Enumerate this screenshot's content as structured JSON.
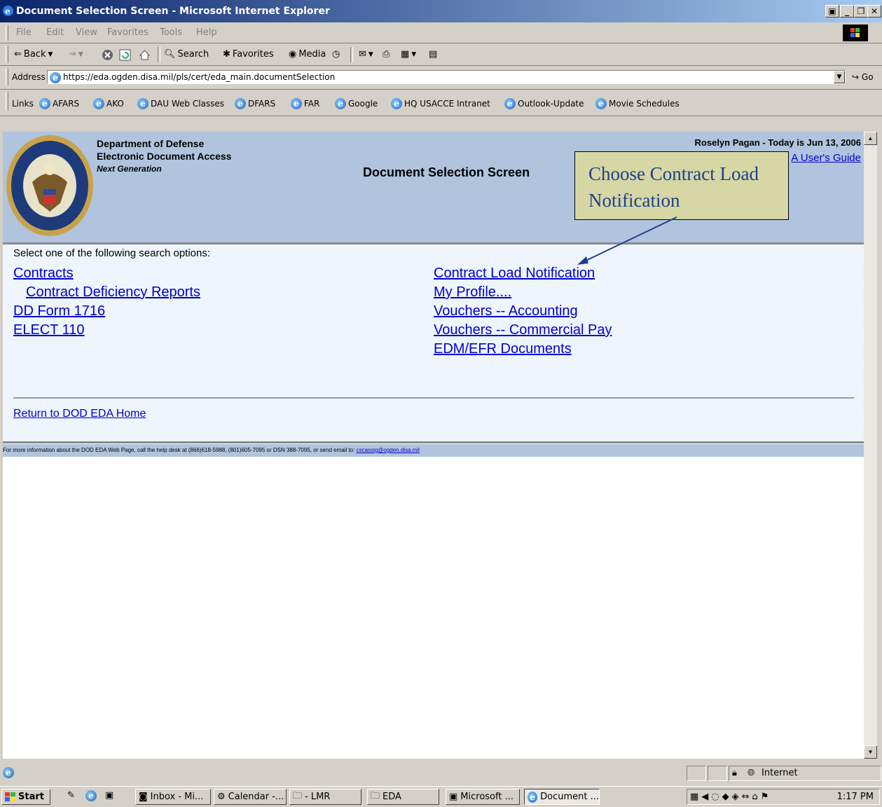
{
  "window": {
    "title": "Document Selection Screen - Microsoft Internet Explorer"
  },
  "menu": [
    "File",
    "Edit",
    "View",
    "Favorites",
    "Tools",
    "Help"
  ],
  "toolbar": {
    "back": "Back",
    "search": "Search",
    "favorites": "Favorites",
    "media": "Media"
  },
  "address": {
    "label": "Address",
    "url": "https://eda.ogden.disa.mil/pls/cert/eda_main.documentSelection",
    "go": "Go"
  },
  "links": {
    "label": "Links",
    "items": [
      "AFARS",
      "AKO",
      "DAU Web Classes",
      "DFARS",
      "FAR",
      "Google",
      "HQ USACCE Intranet",
      "Outlook-Update",
      "Movie Schedules"
    ]
  },
  "page": {
    "org_line1": "Department of Defense",
    "org_line2": "Electronic Document Access",
    "org_line3": "Next Generation",
    "title": "Document Selection Screen",
    "user_date": "Roselyn Pagan - Today is Jun 13, 2006",
    "guide_link": "A User's Guide",
    "callout": "Choose Contract Load Notification",
    "prompt": "Select one of the following search options:",
    "left_links": [
      "Contracts",
      "Contract Deficiency Reports",
      "DD Form 1716",
      "ELECT 110"
    ],
    "right_links": [
      "Contract Load Notification",
      "My Profile....",
      "Vouchers -- Accounting",
      "Vouchers -- Commercial Pay",
      "EDM/EFR Documents"
    ],
    "return_link": "Return to DOD EDA Home",
    "footer_text": "For more information about the DOD EDA Web Page, call the help desk at (866)618-5988, (801)605-7095 or DSN 388-7095, or send email to: ",
    "footer_email": "cscassig@ogden.disa.mil"
  },
  "status": {
    "zone": "Internet"
  },
  "taskbar": {
    "start": "Start",
    "tasks": [
      "Inbox - Mi...",
      "Calendar -...",
      "- LMR",
      "EDA",
      "Microsoft ...",
      "Document ..."
    ],
    "time": "1:17 PM"
  },
  "colors": {
    "header_bg": "#b0c4de",
    "content_bg": "#eef5fc",
    "link": "#0000cc",
    "callout_bg": "#d6d7a5",
    "callout_text": "#1f3f8c"
  }
}
